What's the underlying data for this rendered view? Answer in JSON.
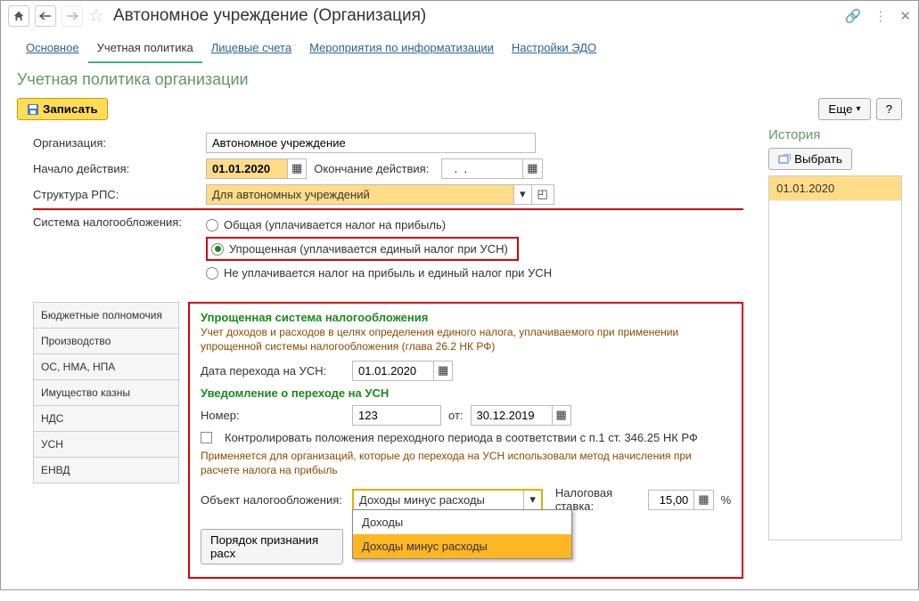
{
  "title": "Автономное учреждение (Организация)",
  "nav": {
    "main": "Основное",
    "policy": "Учетная политика",
    "accounts": "Лицевые счета",
    "it": "Мероприятия по информатизации",
    "edo": "Настройки ЭДО"
  },
  "subtitle": "Учетная политика организации",
  "buttons": {
    "save": "Записать",
    "more": "Еще",
    "help": "?",
    "select": "Выбрать",
    "order": "Порядок признания расх"
  },
  "fields": {
    "org_label": "Организация:",
    "org_value": "Автономное учреждение",
    "start_label": "Начало действия:",
    "start_value": "01.01.2020",
    "end_label": "Окончание действия:",
    "end_value": "  .  .",
    "rps_label": "Структура РПС:",
    "rps_value": "Для автономных учреждений",
    "tax_label": "Система налогообложения:"
  },
  "radios": {
    "general": "Общая (уплачивается налог на прибыль)",
    "usn": "Упрощенная (уплачивается единый налог при УСН)",
    "none": "Не уплачивается налог на прибыль и единый налог при УСН"
  },
  "side": {
    "budget": "Бюджетные полномочия",
    "prod": "Производство",
    "os": "ОС, НМА, НПА",
    "treasury": "Имущество казны",
    "nds": "НДС",
    "usn": "УСН",
    "envd": "ЕНВД"
  },
  "usn": {
    "head": "Упрощенная система налогообложения",
    "desc": "Учет доходов и расходов в целях определения единого налога, уплачиваемого при применении упрощенной системы налогообложения (глава 26.2 НК РФ)",
    "date_label": "Дата перехода на УСН:",
    "date_value": "01.01.2020",
    "notice_head": "Уведомление о переходе на УСН",
    "num_label": "Номер:",
    "num_value": "123",
    "from_label": "от:",
    "from_value": "30.12.2019",
    "check_label": "Контролировать положения переходного периода в соответствии с п.1 ст. 346.25 НК РФ",
    "check_desc": "Применяется для организаций, которые до перехода на УСН использовали метод начисления при расчете налога на прибыль",
    "obj_label": "Объект налогообложения:",
    "obj_value": "Доходы минус расходы",
    "opt1": "Доходы",
    "opt2": "Доходы минус расходы",
    "rate_label": "Налоговая ставка:",
    "rate_value": "15,00",
    "rate_unit": "%"
  },
  "history": {
    "head": "История",
    "item": "01.01.2020"
  }
}
